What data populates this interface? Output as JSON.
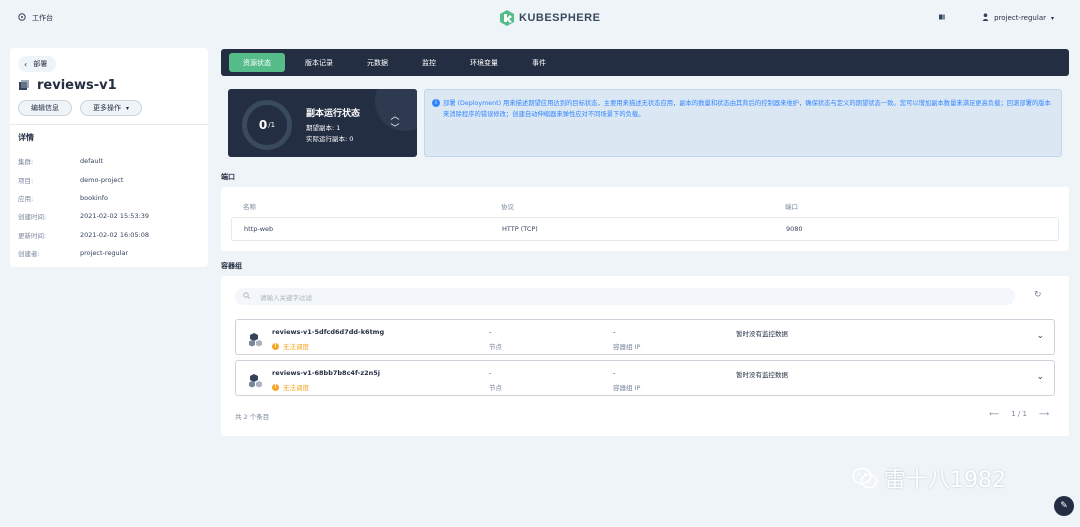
{
  "topbar": {
    "workbench_label": "工作台",
    "logo_text": "KUBESPHERE",
    "user_name": "project-regular",
    "brand_color": "#55bc8a"
  },
  "sidebar": {
    "back_label": "部署",
    "title": "reviews-v1",
    "edit_button": "编辑信息",
    "more_button": "更多操作",
    "details_heading": "详情",
    "details": [
      {
        "key": "集群:",
        "value": "default"
      },
      {
        "key": "项目:",
        "value": "demo-project"
      },
      {
        "key": "应用:",
        "value": "bookinfo"
      },
      {
        "key": "创建时间:",
        "value": "2021-02-02 15:53:39"
      },
      {
        "key": "更新时间:",
        "value": "2021-02-02 16:05:08"
      },
      {
        "key": "创建者:",
        "value": "project-regular"
      }
    ]
  },
  "tabs": [
    {
      "label": "资源状态",
      "active": true
    },
    {
      "label": "版本记录",
      "active": false
    },
    {
      "label": "元数据",
      "active": false
    },
    {
      "label": "监控",
      "active": false
    },
    {
      "label": "环境变量",
      "active": false
    },
    {
      "label": "事件",
      "active": false
    }
  ],
  "replica_status": {
    "current": "0",
    "desired": "/1",
    "title": "副本运行状态",
    "desired_line": "期望副本: 1",
    "actual_line": "实际运行副本: 0"
  },
  "info_text": "部署 (Deployment) 用来描述期望应用达到的目标状态，主要用来描述无状态应用，副本的数量和状态由其背后的控制器来维护，确保状态与定义的期望状态一致。您可以增加副本数量来满足更高负载；回滚部署的版本来消除程序的错误修改；创建自动伸缩器来弹性应对不同场景下的负载。",
  "ports": {
    "section_label": "端口",
    "headers": [
      "名称",
      "协议",
      "端口"
    ],
    "rows": [
      {
        "name": "http-web",
        "protocol": "HTTP (TCP)",
        "port": "9080"
      }
    ]
  },
  "pods": {
    "section_label": "容器组",
    "search_placeholder": "请输入关键字过滤",
    "items": [
      {
        "name": "reviews-v1-5dfcd6d7dd-k6tmg",
        "status": "无法调度",
        "node": "-",
        "node_label": "节点",
        "ip": "-",
        "ip_label": "容器组 IP",
        "monitor": "暂时没有监控数据"
      },
      {
        "name": "reviews-v1-68bb7b8c4f-z2n5j",
        "status": "无法调度",
        "node": "-",
        "node_label": "节点",
        "ip": "-",
        "ip_label": "容器组 IP",
        "monitor": "暂时没有监控数据"
      }
    ],
    "total": "共 2 个条目",
    "page": "1 / 1"
  },
  "watermark": "雷十八1982"
}
